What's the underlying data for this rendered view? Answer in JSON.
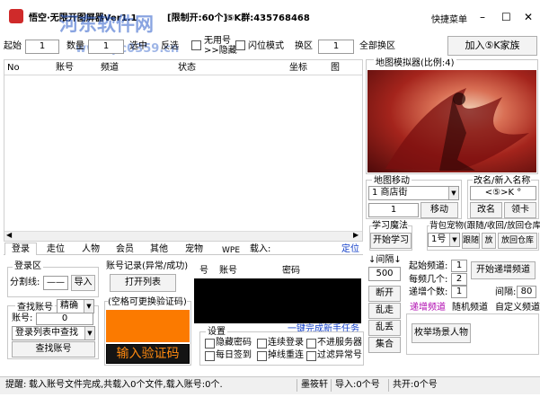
{
  "titlebar": {
    "title": "悟空·无限开图屏器Ver1.1",
    "limit": "[限制开:60个]",
    "qq": "⑤K群:435768468",
    "shortcut": "快捷菜单",
    "min": "–",
    "max": "☐",
    "close": "✕"
  },
  "watermark": {
    "site": "河东软件网",
    "url": "www.pc0359.cn"
  },
  "toolbar": {
    "start_label": "起始",
    "start_value": "1",
    "count_label": "数量",
    "count_value": "1",
    "select_label": "选中",
    "invert_label": "反选",
    "unlimited_label": "无用号",
    "hide_label": ">>隐藏",
    "flash_label": "闪位模式",
    "switch_label": "换区",
    "switch_value": "1",
    "switch_all": "全部换区",
    "join": "加入⑤K家族"
  },
  "table": {
    "headers": [
      "No",
      "账号",
      "频道",
      "状态",
      "坐标",
      "图"
    ]
  },
  "map": {
    "title": "地图模拟器(比例:4)"
  },
  "map_move": {
    "title": "地图移动",
    "location": "1 商店街",
    "value": "1",
    "move": "移动"
  },
  "rename": {
    "title": "改名/新入名称",
    "value": "<⑤>K °",
    "rename": "改名",
    "receive": "领卡"
  },
  "learn": {
    "title": "学习魔法",
    "start": "开始学习"
  },
  "bag": {
    "title": "背包宠物(跟随/收回/放回仓库)",
    "select": "1号",
    "follow": "跟随",
    "release": "放",
    "return": "放回仓库"
  },
  "interval": {
    "label": "↓间隔↓",
    "value": "500"
  },
  "side_buttons": {
    "disconnect": "断开",
    "walk": "乱走",
    "hit": "乱丢",
    "gather": "集合"
  },
  "channel": {
    "start_label": "起始频道:",
    "start_value": "1",
    "each_label": "每频几个:",
    "each_value": "2",
    "step_label": "递增个数:",
    "step_value": "1",
    "start_btn": "开始递增频道",
    "interval_label": "间隔:",
    "interval_value": "80",
    "tabs": [
      "递增频道",
      "随机频道",
      "自定义频道"
    ],
    "search": "枚举场景人物"
  },
  "tabs": [
    "登录",
    "走位",
    "人物",
    "会员",
    "其他",
    "宠物",
    "WPE",
    "载入:",
    "定位"
  ],
  "login": {
    "group_title": "登录区",
    "split_label": "分割线:",
    "split_value": "——",
    "import": "导入",
    "find_title": "查找账号",
    "find_mode": "精确",
    "account_label": "账号:",
    "account_value": "0",
    "find_in_list": "登录列表中查找",
    "find_btn": "查找账号"
  },
  "record": {
    "title": "账号记录(异常/成功)",
    "open": "打开列表",
    "captcha_hint": "(空格可更换验证码)",
    "captcha_btn": "输入验证码"
  },
  "grid": {
    "headers": [
      "号",
      "账号",
      "密码"
    ]
  },
  "settings": {
    "title": "设置",
    "link": "一键完成新手任务",
    "options": [
      "隐藏密码",
      "连续登录",
      "不进服务器",
      "每日签到",
      "掉线重连",
      "过滤异常号"
    ]
  },
  "status": {
    "tip": "提醒:",
    "message": "载入账号文件完成,共载入0个文件,载入账号:0个.",
    "author": "墨筱轩",
    "imported": "导入:0个号",
    "total": "共开:0个号"
  }
}
